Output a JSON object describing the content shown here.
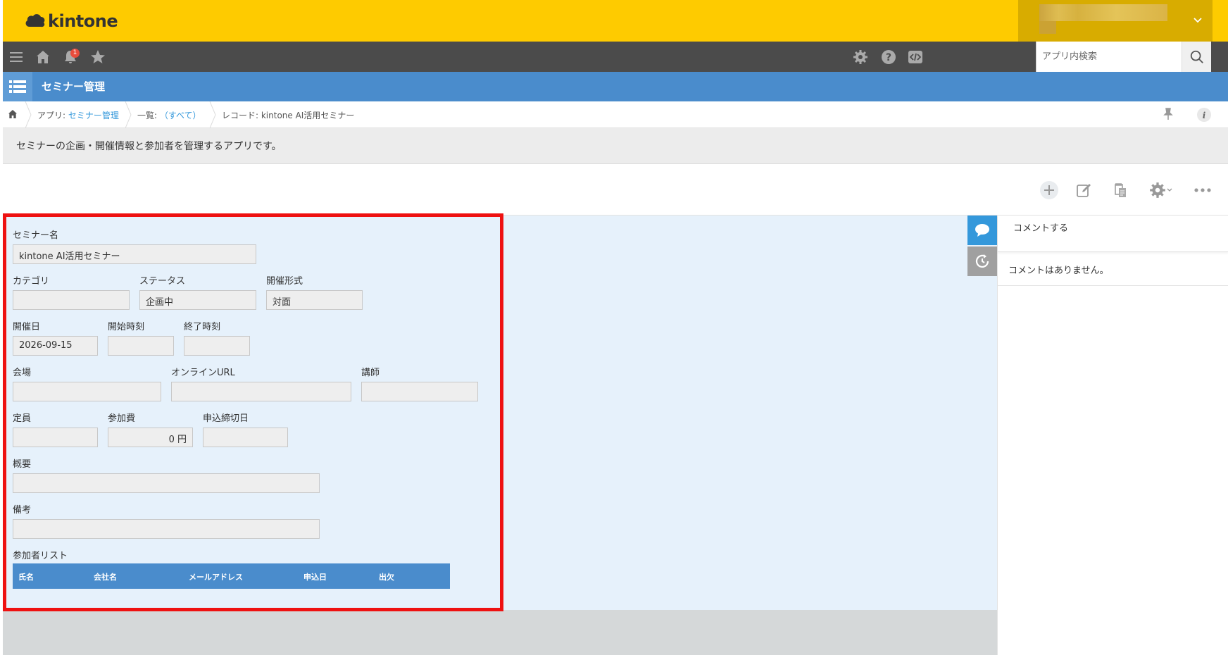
{
  "header": {
    "logo_text": "kintone",
    "notification_count": "1"
  },
  "search": {
    "placeholder": "アプリ内検索"
  },
  "app": {
    "title": "セミナー管理",
    "description": "セミナーの企画・開催情報と参加者を管理するアプリです。"
  },
  "breadcrumb": {
    "app_prefix": "アプリ: ",
    "app_name": "セミナー管理",
    "list_prefix": "一覧: ",
    "list_name": "（すべて）",
    "record_label": "レコード: kintone AI活用セミナー"
  },
  "fields": {
    "seminar_name": {
      "label": "セミナー名",
      "value": "kintone AI活用セミナー"
    },
    "category": {
      "label": "カテゴリ",
      "value": ""
    },
    "status": {
      "label": "ステータス",
      "value": "企画中"
    },
    "format": {
      "label": "開催形式",
      "value": "対面"
    },
    "date": {
      "label": "開催日",
      "value": "2026-09-15"
    },
    "start_time": {
      "label": "開始時刻",
      "value": ""
    },
    "end_time": {
      "label": "終了時刻",
      "value": ""
    },
    "venue": {
      "label": "会場",
      "value": ""
    },
    "online_url": {
      "label": "オンラインURL",
      "value": ""
    },
    "lecturer": {
      "label": "講師",
      "value": ""
    },
    "capacity": {
      "label": "定員",
      "value": ""
    },
    "fee": {
      "label": "参加費",
      "value": "0 円"
    },
    "deadline": {
      "label": "申込締切日",
      "value": ""
    },
    "summary": {
      "label": "概要",
      "value": ""
    },
    "notes": {
      "label": "備考",
      "value": ""
    },
    "participants": {
      "label": "参加者リスト",
      "columns": [
        "氏名",
        "会社名",
        "メールアドレス",
        "申込日",
        "出欠"
      ]
    }
  },
  "sidebar": {
    "comment_placeholder": "コメントする",
    "no_comments": "コメントはありません。"
  },
  "colors": {
    "header_yellow": "#fecb00",
    "nav_dark": "#4b4b4b",
    "app_blue": "#4a8ccc",
    "highlight_red": "#ee1111"
  }
}
